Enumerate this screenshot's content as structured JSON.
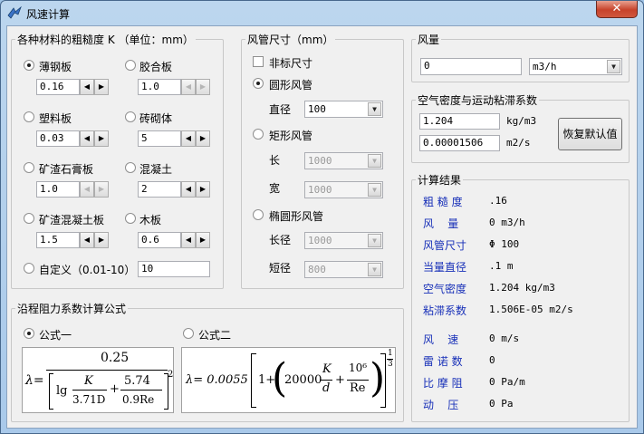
{
  "window": {
    "title": "风速计算",
    "close_label": "✕"
  },
  "roughness": {
    "legend": "各种材料的粗糙度 K （单位：mm）",
    "materials": [
      {
        "label": "薄钢板",
        "value": "0.16",
        "selected": true
      },
      {
        "label": "胶合板",
        "value": "1.0"
      },
      {
        "label": "塑料板",
        "value": "0.03"
      },
      {
        "label": "砖砌体",
        "value": "5"
      },
      {
        "label": "矿渣石膏板",
        "value": "1.0"
      },
      {
        "label": "混凝土",
        "value": "2"
      },
      {
        "label": "矿渣混凝土板",
        "value": "1.5"
      },
      {
        "label": "木板",
        "value": "0.6"
      }
    ],
    "custom_label": "自定义（0.01-10）",
    "custom_value": "10",
    "spin_left": "◀",
    "spin_right": "▶"
  },
  "duct": {
    "legend": "风管尺寸（mm）",
    "nonstandard_label": "非标尺寸",
    "round_label": "圆形风管",
    "diameter_label": "直径",
    "diameter_value": "100",
    "rect_label": "矩形风管",
    "length_label": "长",
    "length_value": "1000",
    "width_label": "宽",
    "width_value": "1000",
    "oval_label": "椭圆形风管",
    "major_label": "长径",
    "major_value": "1000",
    "minor_label": "短径",
    "minor_value": "800",
    "arrow": "▼"
  },
  "airflow": {
    "legend": "风量",
    "value": "0",
    "unit": "m3/h"
  },
  "air": {
    "legend": "空气密度与运动粘滞系数",
    "density_value": "1.204",
    "density_unit": "kg/m3",
    "viscosity_value": "0.00001506",
    "viscosity_unit": "m2/s",
    "reset_label": "恢复默认值"
  },
  "results": {
    "legend": "计算结果",
    "rows": [
      {
        "label": "粗 糙 度",
        "value": ".16"
      },
      {
        "label": "风    量",
        "value": "0 m3/h"
      },
      {
        "label": "风管尺寸",
        "value": "Φ 100"
      },
      {
        "label": "当量直径",
        "value": ".1 m"
      },
      {
        "label": "空气密度",
        "value": "1.204 kg/m3"
      },
      {
        "label": "粘滞系数",
        "value": "1.506E-05 m2/s"
      },
      {
        "label": "风    速",
        "value": "0 m/s"
      },
      {
        "label": "雷 诺 数",
        "value": "0"
      },
      {
        "label": "比 摩 阻",
        "value": "0 Pa/m"
      },
      {
        "label": "动    压",
        "value": "0 Pa"
      }
    ]
  },
  "formula": {
    "legend": "沿程阻力系数计算公式",
    "f1_label": "公式一",
    "f2_label": "公式二",
    "f1": {
      "lambda": "λ=",
      "numer": "0.25",
      "lg": "lg",
      "k": "K",
      "d1": "3.71D",
      "plus": "+",
      "c": "5.74",
      "re": "0.9Re",
      "exp": "2"
    },
    "f2": {
      "lhs": "λ= 0.0055",
      "one_plus": "1+",
      "coef": "20000",
      "k": "K",
      "d": "d",
      "plus": "+",
      "ten6": "10⁶",
      "re": "Re",
      "exp_n": "1",
      "exp_d": "3"
    }
  }
}
